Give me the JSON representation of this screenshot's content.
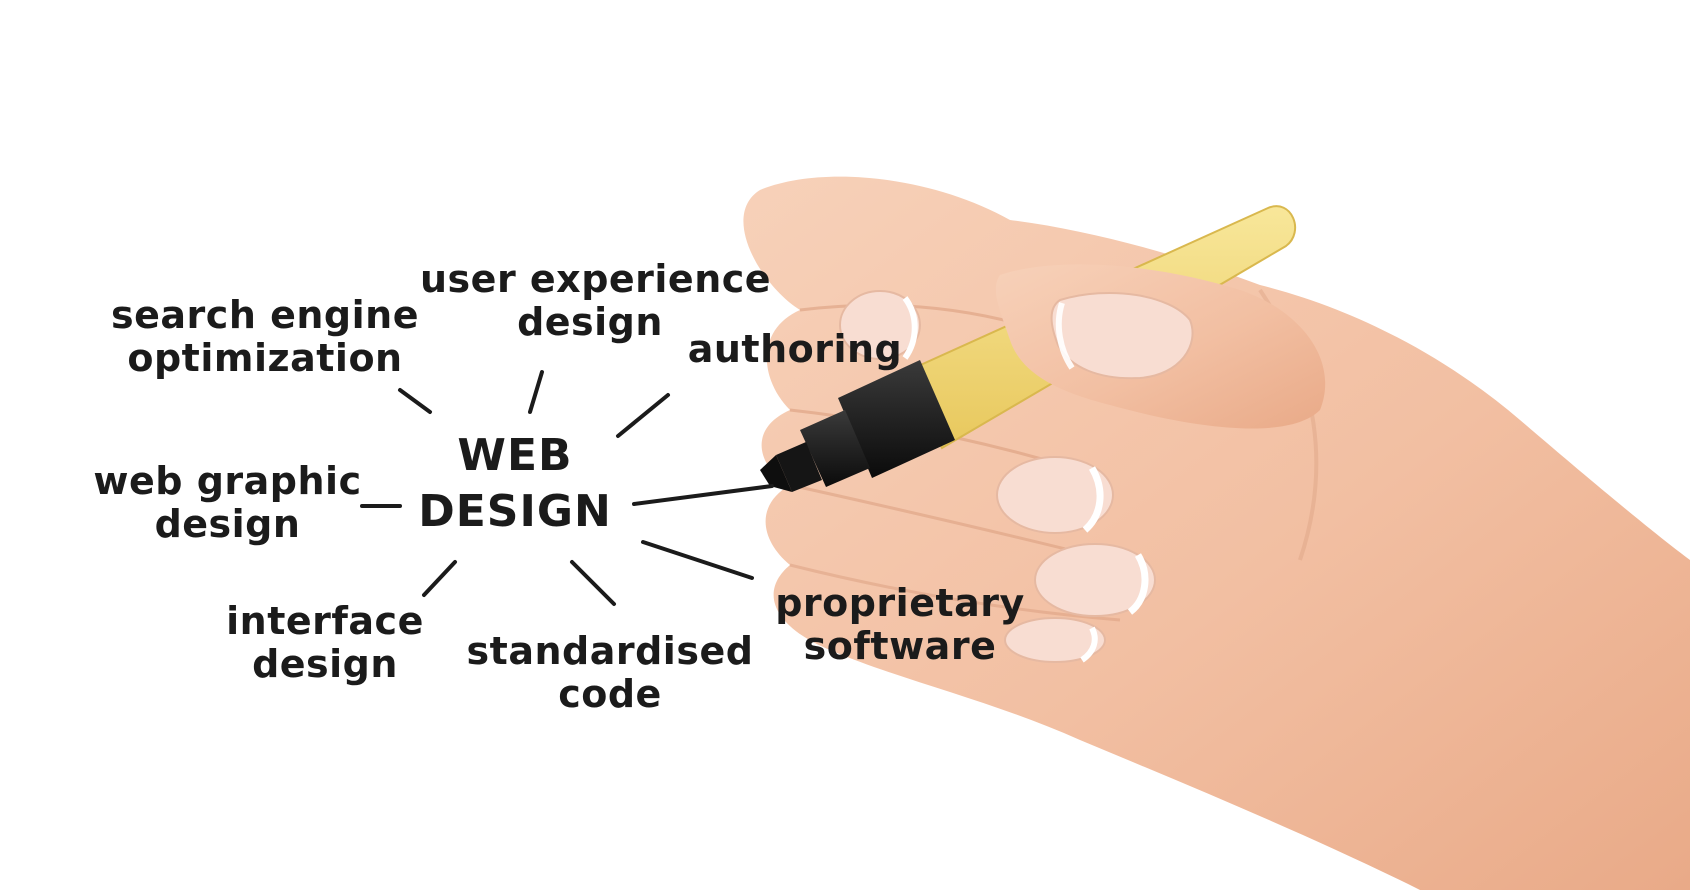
{
  "center": {
    "line1": "WEB",
    "line2": "DESIGN"
  },
  "topics": {
    "seo": {
      "line1": "search engine",
      "line2": "optimization"
    },
    "ux": {
      "line1": "user experience",
      "line2": "design"
    },
    "authoring": {
      "line1": "authoring"
    },
    "web_graphic": {
      "line1": "web graphic",
      "line2": "design"
    },
    "interface": {
      "line1": "interface",
      "line2": "design"
    },
    "standardised": {
      "line1": "standardised",
      "line2": "code"
    },
    "proprietary": {
      "line1": "proprietary",
      "line2": "software"
    }
  },
  "colors": {
    "ink": "#1b1b1b",
    "skin": "#f4c5aa",
    "nail": "#f8ddd2",
    "marker_barrel": "#f3dc7c",
    "marker_cap": "#1c1c1c"
  }
}
